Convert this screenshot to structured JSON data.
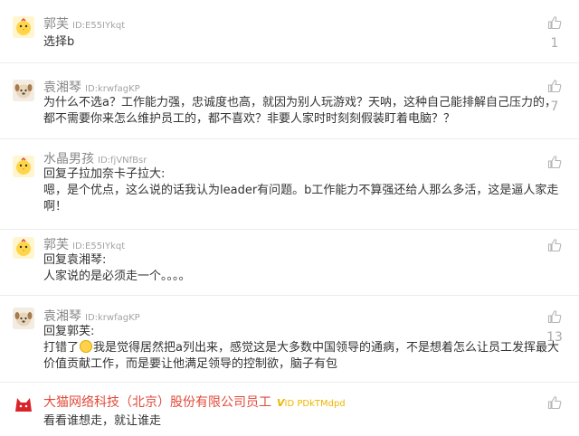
{
  "comments": [
    {
      "nickname": "郭芙",
      "user_id": "ID:E55IYkqt",
      "avatar": "chick-icon",
      "lines": [
        "选择b"
      ],
      "likes": "1"
    },
    {
      "nickname": "袁湘琴",
      "user_id": "ID:krwfagKP",
      "avatar": "dog-icon",
      "lines": [
        "为什么不选a？工作能力强，忠诚度也高，就因为别人玩游戏？天呐，这种自己能排解自己压力的，",
        "都不需要你来怎么维护员工的，都不喜欢？非要人家时时刻刻假装盯着电脑？？"
      ],
      "likes": "7"
    },
    {
      "nickname": "水晶男孩",
      "user_id": "ID:fjVNfBsr",
      "avatar": "chick-icon",
      "lines": [
        "回复子拉加奈卡子拉大:",
        "嗯，是个优点，这么说的话我认为leader有问题。b工作能力不算强还给人那么多活，这是逼人家走",
        "啊！"
      ],
      "likes": ""
    },
    {
      "nickname": "郭芙",
      "user_id": "ID:E55IYkqt",
      "avatar": "chick-icon",
      "lines": [
        "回复袁湘琴:",
        "人家说的是必须走一个。。。。"
      ],
      "likes": ""
    },
    {
      "nickname": "袁湘琴",
      "user_id": "ID:krwfagKP",
      "avatar": "dog-icon",
      "reply_to": "回复郭芙:",
      "line2_before": "打错了",
      "line2_after": "我是觉得居然把a列出来，感觉这是大多数中国领导的通病，不是想着怎么让员工发挥最大",
      "line3": "价值贡献工作，而是要让他满足领导的控制欲，脑子有包",
      "emoji": "grinning-face-emoji",
      "likes": "13"
    },
    {
      "nickname": "大猫网络科技（北京）股份有限公司员工",
      "vip_badge": "V",
      "user_id": "ID PDkTMdpd",
      "avatar": "cat-logo-icon",
      "lines": [
        "看看谁想走，就让谁走"
      ],
      "likes": ""
    }
  ],
  "colors": {
    "nickname": "#888888",
    "vip_name": "#e14a3a",
    "vip_badge": "#f0b400",
    "text": "#333333",
    "like_icon": "#b5b5b5"
  }
}
